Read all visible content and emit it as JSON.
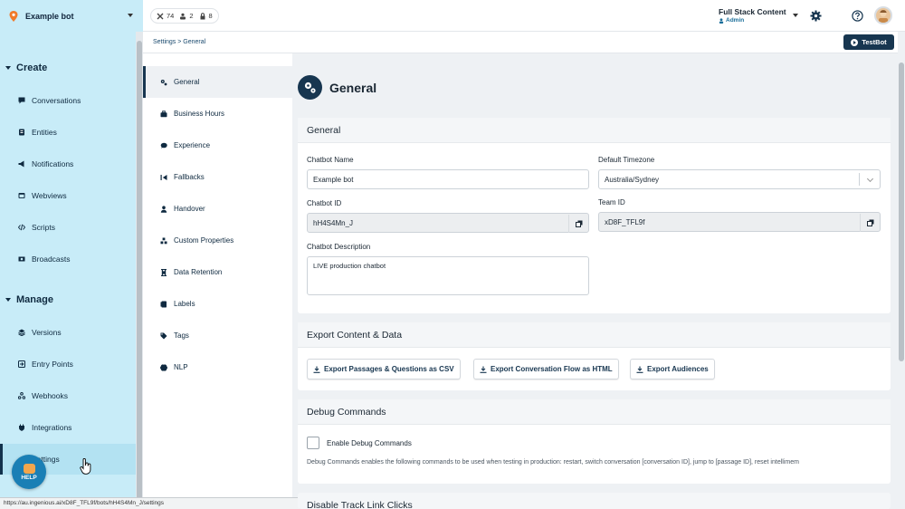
{
  "bot_selector": {
    "name": "Example bot"
  },
  "stats": {
    "passages": "74",
    "users": "2",
    "locks": "8"
  },
  "account": {
    "name": "Full Stack Content",
    "role": "Admin"
  },
  "sidebar": {
    "create_label": "Create",
    "create_items": [
      {
        "label": "Conversations",
        "icon": "chat-icon"
      },
      {
        "label": "Entities",
        "icon": "entity-icon"
      },
      {
        "label": "Notifications",
        "icon": "bullhorn-icon"
      },
      {
        "label": "Webviews",
        "icon": "window-icon"
      },
      {
        "label": "Scripts",
        "icon": "code-icon"
      },
      {
        "label": "Broadcasts",
        "icon": "broadcast-icon"
      }
    ],
    "manage_label": "Manage",
    "manage_items": [
      {
        "label": "Versions",
        "icon": "layers-icon"
      },
      {
        "label": "Entry Points",
        "icon": "entry-icon"
      },
      {
        "label": "Webhooks",
        "icon": "webhook-icon"
      },
      {
        "label": "Integrations",
        "icon": "plug-icon"
      },
      {
        "label": "Settings",
        "icon": "gear-icon",
        "active": true
      }
    ]
  },
  "help_button": {
    "label": "HELP"
  },
  "status_url": "https://au.ingenious.ai/xD8F_TFL9f/bots/hH4S4Mn_J/settings",
  "breadcrumb": {
    "text": "Settings > General"
  },
  "testbot": {
    "label": "TestBot"
  },
  "settings_menu": [
    {
      "label": "General",
      "icon": "gears-icon",
      "active": true
    },
    {
      "label": "Business Hours",
      "icon": "briefcase-icon"
    },
    {
      "label": "Experience",
      "icon": "comment-icon"
    },
    {
      "label": "Fallbacks",
      "icon": "fallback-icon"
    },
    {
      "label": "Handover",
      "icon": "person-icon"
    },
    {
      "label": "Custom Properties",
      "icon": "cubes-icon"
    },
    {
      "label": "Data Retention",
      "icon": "hourglass-icon"
    },
    {
      "label": "Labels",
      "icon": "label-icon"
    },
    {
      "label": "Tags",
      "icon": "tags-icon"
    },
    {
      "label": "NLP",
      "icon": "brain-icon"
    }
  ],
  "page": {
    "title": "General"
  },
  "general_card": {
    "header": "General",
    "chatbot_name_label": "Chatbot Name",
    "chatbot_name_value": "Example bot",
    "timezone_label": "Default Timezone",
    "timezone_value": "Australia/Sydney",
    "chatbot_id_label": "Chatbot ID",
    "chatbot_id_value": "hH4S4Mn_J",
    "team_id_label": "Team ID",
    "team_id_value": "xD8F_TFL9f",
    "description_label": "Chatbot Description",
    "description_value": "LIVE production chatbot"
  },
  "export_card": {
    "header": "Export Content & Data",
    "btn1": "Export Passages & Questions as CSV",
    "btn2": "Export Conversation Flow as HTML",
    "btn3": "Export Audiences"
  },
  "debug_card": {
    "header": "Debug Commands",
    "checkbox_label": "Enable Debug Commands",
    "note": "Debug Commands enables the following commands to be used when testing in production: restart, switch conversation [conversation ID], jump to [passage ID], reset intellimem"
  },
  "track_card": {
    "header": "Disable Track Link Clicks"
  },
  "colors": {
    "nav_bg": "#c8ecf8",
    "primary": "#173650",
    "page_bg": "#eef1f4"
  }
}
